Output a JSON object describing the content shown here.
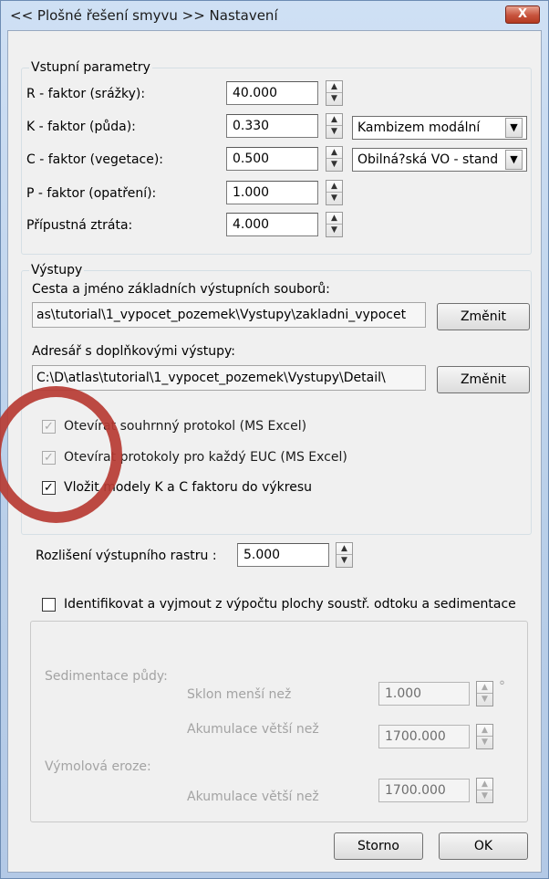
{
  "window": {
    "title": "<< Plošné řešení smyvu >>  Nastavení",
    "close_label": "X"
  },
  "inputs_group": {
    "title": "Vstupní parametry",
    "rows": [
      {
        "label": "R - faktor (srážky):",
        "value": "40.000"
      },
      {
        "label": "K - faktor (půda):",
        "value": "0.330",
        "combo": "Kambizem modální"
      },
      {
        "label": "C - faktor (vegetace):",
        "value": "0.500",
        "combo": "Obilná?ská VO - stand"
      },
      {
        "label": "P - faktor (opatření):",
        "value": "1.000"
      },
      {
        "label": "Přípustná ztráta:",
        "value": "4.000"
      }
    ]
  },
  "outputs_group": {
    "title": "Výstupy",
    "main_path_label": "Cesta a jméno základních výstupních souborů:",
    "main_path_value": "as\\tutorial\\1_vypocet_pozemek\\Vystupy\\zakladni_vypocet",
    "main_change_label": "Změnit",
    "detail_path_label": "Adresář s doplňkovými výstupy:",
    "detail_path_value": "C:\\D\\atlas\\tutorial\\1_vypocet_pozemek\\Vystupy\\Detail\\",
    "detail_change_label": "Změnit",
    "checkboxes": [
      {
        "label": "Otevírat souhrnný protokol (MS Excel)",
        "checked": true,
        "enabled": false
      },
      {
        "label": "Otevírat protokoly pro každý EUC (MS Excel)",
        "checked": true,
        "enabled": false
      },
      {
        "label": "Vložit modely K a C faktoru do výkresu",
        "checked": true,
        "enabled": true
      }
    ]
  },
  "raster": {
    "label": "Rozlišení výstupního rastru :",
    "value": "5.000"
  },
  "identify": {
    "label": "Identifikovat a vyjmout z výpočtu plochy soustř. odtoku a sedimentace",
    "checked": false
  },
  "sedimentation": {
    "soil_label": "Sedimentace půdy:",
    "slope_label": "Sklon menší než",
    "slope_value": "1.000",
    "slope_unit": "°",
    "accum_label": "Akumulace větší než",
    "accum_value": "1700.000",
    "gully_label": "Výmolová eroze:",
    "gully_accum_label": "Akumulace větší než",
    "gully_accum_value": "1700.000"
  },
  "buttons": {
    "cancel": "Storno",
    "ok": "OK"
  },
  "colors": {
    "annotation_circle": "#b73b33",
    "close_button": "#c7533d"
  }
}
